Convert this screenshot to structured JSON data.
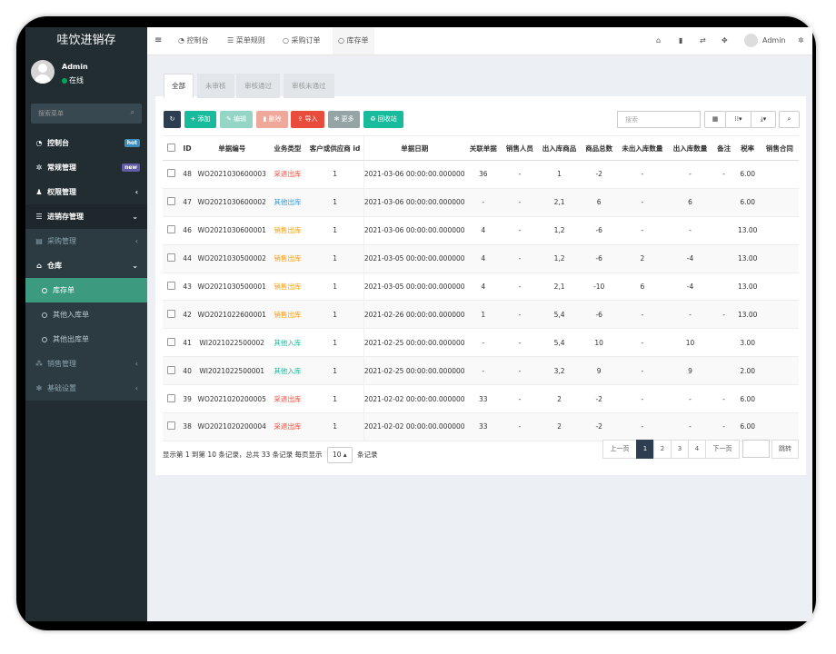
{
  "app": {
    "title": "哇饮进销存"
  },
  "user": {
    "name": "Admin",
    "status": "在线"
  },
  "sidebar": {
    "search_placeholder": "搜索菜单",
    "items": [
      {
        "label": "控制台",
        "icon": "dashboard-icon",
        "badge": "hot",
        "badge_color": "#3c8dbc"
      },
      {
        "label": "常规管理",
        "icon": "gears-icon",
        "badge": "new",
        "badge_color": "#605ca8"
      },
      {
        "label": "权限管理",
        "icon": "group-icon"
      },
      {
        "label": "进销存管理",
        "icon": "list-icon"
      },
      {
        "label": "采购管理",
        "icon": "print-icon"
      },
      {
        "label": "仓库",
        "icon": "bank-icon"
      },
      {
        "label": "库存单"
      },
      {
        "label": "其他入库单"
      },
      {
        "label": "其他出库单"
      },
      {
        "label": "销售管理",
        "icon": "cubes-icon"
      },
      {
        "label": "基础设置",
        "icon": "cog-icon"
      }
    ]
  },
  "topbar": {
    "tabs": [
      "控制台",
      "菜单规则",
      "采购订单",
      "库存单"
    ],
    "user": "Admin"
  },
  "filter_tabs": [
    "全部",
    "未审核",
    "审核通过",
    "审核未通过"
  ],
  "toolbar": {
    "add": "添加",
    "edit": "编辑",
    "delete": "删除",
    "import": "导入",
    "more": "更多",
    "recycle": "回收站",
    "search_placeholder": "搜索"
  },
  "colors": {
    "add": "#18bc9c",
    "edit": "#95d5c6",
    "delete": "#f0a89b",
    "import": "#e74c3c",
    "more": "#95a5a6",
    "recycle": "#18bc9c",
    "refresh": "#2c3e50",
    "red": "#e74c3c",
    "blue": "#3498db",
    "orange": "#f39c12",
    "green": "#18bc9c"
  },
  "table": {
    "headers": [
      "ID",
      "单据编号",
      "业务类型",
      "客户或供应商 id",
      "单据日期",
      "关联单据",
      "销售人员",
      "出入库商品",
      "商品总数",
      "未出入库数量",
      "出入库数量",
      "备注",
      "税率",
      "销售合同"
    ],
    "rows": [
      {
        "id": "48",
        "no": "WO2021030600003",
        "type": "采退出库",
        "type_color": "red",
        "cust": "1",
        "date": "2021-03-06 00:00:00.000000",
        "rel": "36",
        "sales": "-",
        "goods": "1",
        "total": "-2",
        "unout": "-",
        "out": "-",
        "note": "-",
        "tax": "6.00",
        "contract": ""
      },
      {
        "id": "47",
        "no": "WO2021030600002",
        "type": "其他出库",
        "type_color": "blue",
        "cust": "1",
        "date": "2021-03-06 00:00:00.000000",
        "rel": "-",
        "sales": "-",
        "goods": "2,1",
        "total": "6",
        "unout": "-",
        "out": "6",
        "note": "",
        "tax": "6.00",
        "contract": ""
      },
      {
        "id": "46",
        "no": "WO2021030600001",
        "type": "销售出库",
        "type_color": "orange",
        "cust": "1",
        "date": "2021-03-06 00:00:00.000000",
        "rel": "4",
        "sales": "-",
        "goods": "1,2",
        "total": "-6",
        "unout": "-",
        "out": "-",
        "note": "",
        "tax": "13.00",
        "contract": ""
      },
      {
        "id": "44",
        "no": "WO2021030500002",
        "type": "销售出库",
        "type_color": "orange",
        "cust": "1",
        "date": "2021-03-05 00:00:00.000000",
        "rel": "4",
        "sales": "-",
        "goods": "1,2",
        "total": "-6",
        "unout": "2",
        "out": "-4",
        "note": "",
        "tax": "13.00",
        "contract": ""
      },
      {
        "id": "43",
        "no": "WO2021030500001",
        "type": "销售出库",
        "type_color": "orange",
        "cust": "1",
        "date": "2021-03-05 00:00:00.000000",
        "rel": "4",
        "sales": "-",
        "goods": "2,1",
        "total": "-10",
        "unout": "6",
        "out": "-4",
        "note": "",
        "tax": "13.00",
        "contract": ""
      },
      {
        "id": "42",
        "no": "WO2021022600001",
        "type": "销售出库",
        "type_color": "orange",
        "cust": "1",
        "date": "2021-02-26 00:00:00.000000",
        "rel": "1",
        "sales": "-",
        "goods": "5,4",
        "total": "-6",
        "unout": "-",
        "out": "-",
        "note": "-",
        "tax": "13.00",
        "contract": ""
      },
      {
        "id": "41",
        "no": "WI2021022500002",
        "type": "其他入库",
        "type_color": "green",
        "cust": "1",
        "date": "2021-02-25 00:00:00.000000",
        "rel": "-",
        "sales": "-",
        "goods": "5,4",
        "total": "10",
        "unout": "-",
        "out": "10",
        "note": "",
        "tax": "3.00",
        "contract": ""
      },
      {
        "id": "40",
        "no": "WI2021022500001",
        "type": "其他入库",
        "type_color": "green",
        "cust": "1",
        "date": "2021-02-25 00:00:00.000000",
        "rel": "-",
        "sales": "-",
        "goods": "3,2",
        "total": "9",
        "unout": "-",
        "out": "9",
        "note": "",
        "tax": "2.00",
        "contract": ""
      },
      {
        "id": "39",
        "no": "WO2021020200005",
        "type": "采退出库",
        "type_color": "red",
        "cust": "1",
        "date": "2021-02-02 00:00:00.000000",
        "rel": "33",
        "sales": "-",
        "goods": "2",
        "total": "-2",
        "unout": "-",
        "out": "-",
        "note": "-",
        "tax": "6.00",
        "contract": ""
      },
      {
        "id": "38",
        "no": "WO2021020200004",
        "type": "采退出库",
        "type_color": "red",
        "cust": "1",
        "date": "2021-02-02 00:00:00.000000",
        "rel": "33",
        "sales": "-",
        "goods": "2",
        "total": "-2",
        "unout": "-",
        "out": "-",
        "note": "-",
        "tax": "6.00",
        "contract": ""
      }
    ]
  },
  "footer": {
    "info_prefix": "显示第 1 到第 10 条记录，总共 33 条记录 每页显示",
    "page_size": "10",
    "info_suffix": "条记录"
  },
  "pagination": {
    "prev": "上一页",
    "pages": [
      "1",
      "2",
      "3",
      "4"
    ],
    "next": "下一页",
    "jump": "跳转"
  }
}
